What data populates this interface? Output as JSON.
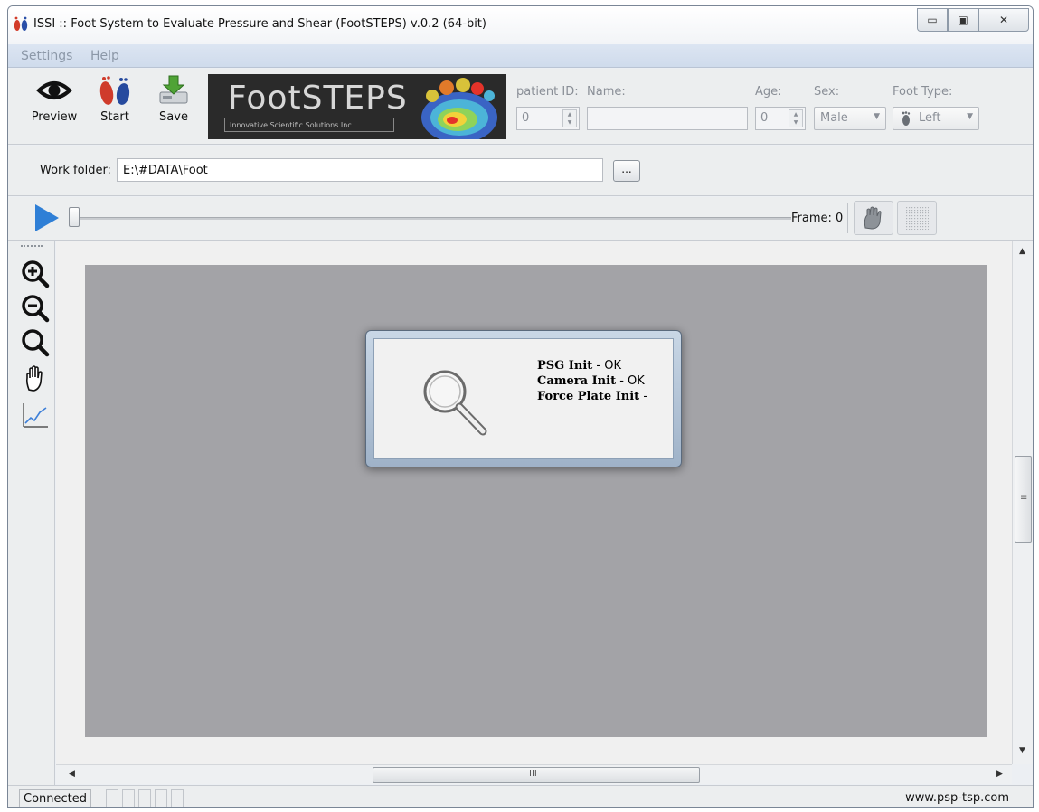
{
  "window": {
    "title": "ISSI :: Foot System to Evaluate Pressure and Shear (FootSTEPS) v.0.2 (64-bit)",
    "controls": {
      "minimize": "▭",
      "maximize": "▣",
      "close": "✕"
    }
  },
  "menu": {
    "items": [
      "Settings",
      "Help"
    ]
  },
  "toolbar": {
    "preview_label": "Preview",
    "start_label": "Start",
    "save_label": "Save",
    "banner_title": "FootSTEPS",
    "banner_subtitle": "Innovative Scientific Solutions Inc."
  },
  "patient": {
    "id_label": "patient ID:",
    "id_value": "0",
    "name_label": "Name:",
    "name_value": "",
    "age_label": "Age:",
    "age_value": "0",
    "sex_label": "Sex:",
    "sex_value": "Male",
    "foot_type_label": "Foot Type:",
    "foot_type_value": "Left"
  },
  "folder": {
    "label": "Work folder:",
    "value": "E:\\#DATA\\Foot",
    "browse_label": "..."
  },
  "playback": {
    "frame_label": "Frame: 0"
  },
  "dialog": {
    "lines": [
      {
        "label": "PSG Init",
        "status": "- OK"
      },
      {
        "label": "Camera Init",
        "status": "- OK"
      },
      {
        "label": "Force Plate Init",
        "status": "-"
      }
    ]
  },
  "scroll": {
    "grip_glyph": "≡",
    "h_grip_glyph": "III"
  },
  "status": {
    "connection": "Connected",
    "url": "www.psp-tsp.com"
  },
  "colors": {
    "accent_blue": "#2f7fd6",
    "canvas_gray": "#a3a3a7",
    "menu_bg": "#d6e0ef"
  }
}
